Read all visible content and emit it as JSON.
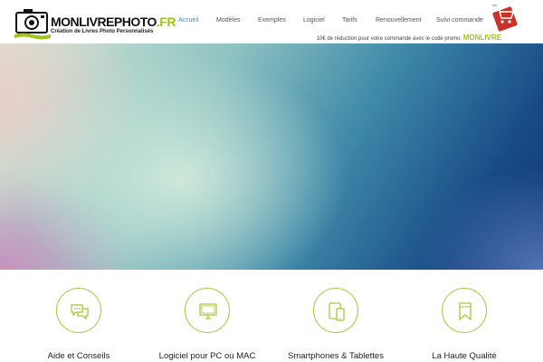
{
  "header": {
    "logo": {
      "word_main": "MONLIVREPHOTO",
      "word_suffix": ".FR",
      "tagline": "Création de Livres Photo Personnalisés"
    },
    "nav": [
      {
        "label": "Accueil",
        "active": true
      },
      {
        "label": "Modèles",
        "active": false
      },
      {
        "label": "Exemples",
        "active": false
      },
      {
        "label": "Logiciel",
        "active": false
      },
      {
        "label": "Tarifs",
        "active": false
      },
      {
        "label": "Renouvellement",
        "active": false
      },
      {
        "label": "Suivi commande",
        "active": false
      }
    ],
    "promo_text": "10€ de réduction pour votre commande avec le code promo:",
    "promo_code": "MONLIVRE",
    "cart_icon": "shopping-cart-icon"
  },
  "features": [
    {
      "title": "Aide et Conseils",
      "icon": "chat-bubbles-icon"
    },
    {
      "title": "Logiciel pour PC ou MAC",
      "icon": "monitor-icon"
    },
    {
      "title": "Smartphones & Tablettes",
      "icon": "devices-icon"
    },
    {
      "title": "La Haute Qualité",
      "icon": "bookmark-icon"
    }
  ],
  "colors": {
    "accent_green": "#9fc41a",
    "nav_active": "#3a8fd0",
    "icon_ring": "#a8c63a"
  }
}
